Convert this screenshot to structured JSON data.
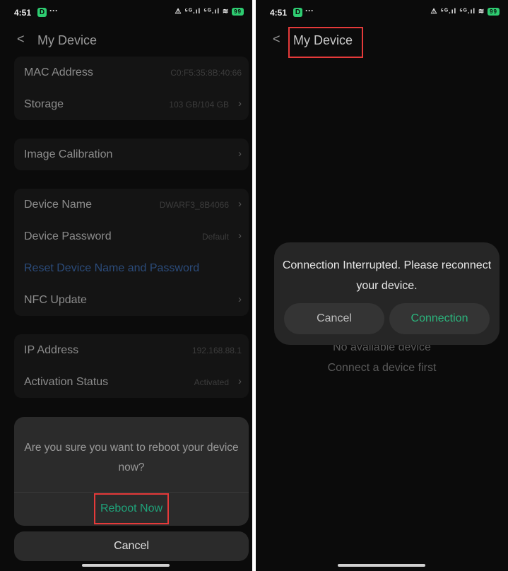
{
  "left": {
    "status": {
      "time": "4:51",
      "badge": "D",
      "dots": "···",
      "icons": "⚠ ⁵ᴳ.ıl ⁵ᴳ.ıl ≋",
      "battery": "99"
    },
    "header": {
      "back": "<",
      "title": "My Device"
    },
    "group1": [
      {
        "label": "MAC Address",
        "value": "C0:F5:35:8B:40:66"
      },
      {
        "label": "Storage",
        "value": "103 GB/104 GB"
      }
    ],
    "group2": [
      {
        "label": "Image Calibration"
      }
    ],
    "group3": [
      {
        "label": "Device Name",
        "value": "DWARF3_8B4066"
      },
      {
        "label": "Device Password",
        "value": "Default"
      },
      {
        "label": "Reset Device Name and Password"
      },
      {
        "label": "NFC Update"
      }
    ],
    "group4": [
      {
        "label": "IP Address",
        "value": "192.168.88.1"
      },
      {
        "label": "Activation Status",
        "value": "Activated"
      }
    ],
    "sheet": {
      "message": "Are you sure you want to reboot your device now?",
      "confirm": "Reboot Now",
      "cancel": "Cancel"
    }
  },
  "right": {
    "status": {
      "time": "4:51",
      "badge": "D",
      "dots": "···",
      "icons": "⚠ ⁵ᴳ.ıl ⁵ᴳ.ıl ≋",
      "battery": "99"
    },
    "header": {
      "back": "<",
      "title": "My Device"
    },
    "empty": {
      "line1": "No available device",
      "line2": "Connect a device first"
    },
    "dialog": {
      "message": "Connection Interrupted. Please reconnect your device.",
      "cancel": "Cancel",
      "connect": "Connection"
    }
  },
  "colors": {
    "accent": "#2bb57d",
    "highlight": "#e53a3a",
    "background": "#0b0b0b"
  }
}
